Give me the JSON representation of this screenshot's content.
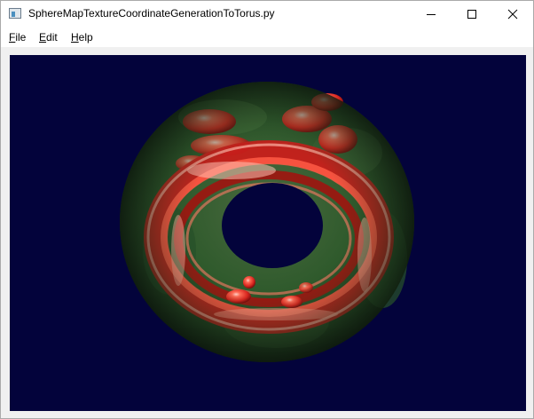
{
  "window": {
    "title": "SphereMapTextureCoordinateGenerationToTorus.py",
    "app_icon": "window-app-icon",
    "controls": {
      "minimize_icon": "minimize-icon",
      "maximize_icon": "maximize-icon",
      "close_icon": "close-icon"
    }
  },
  "menubar": {
    "items": [
      {
        "mnemonic": "F",
        "rest": "ile"
      },
      {
        "mnemonic": "E",
        "rest": "dit"
      },
      {
        "mnemonic": "H",
        "rest": "elp"
      }
    ]
  },
  "viewport": {
    "background_color": "#03033b",
    "object": "sphere-mapped-torus",
    "texture_colors": {
      "foliage": "#2f5a2c",
      "berry": "#e8322a",
      "highlight": "#ffd0c8"
    }
  }
}
